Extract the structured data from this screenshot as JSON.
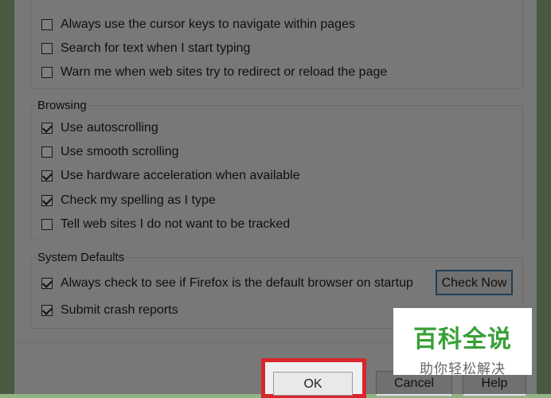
{
  "accessibility": {
    "items": [
      {
        "label": "Always use the cursor keys to navigate within pages",
        "checked": false
      },
      {
        "label": "Search for text when I start typing",
        "checked": false
      },
      {
        "label": "Warn me when web sites try to redirect or reload the page",
        "checked": false
      }
    ]
  },
  "browsing": {
    "title": "Browsing",
    "items": [
      {
        "label": "Use autoscrolling",
        "checked": true
      },
      {
        "label": "Use smooth scrolling",
        "checked": false
      },
      {
        "label": "Use hardware acceleration when available",
        "checked": true
      },
      {
        "label": "Check my spelling as I type",
        "checked": true
      },
      {
        "label": "Tell web sites I do not want to be tracked",
        "checked": false
      }
    ]
  },
  "system_defaults": {
    "title": "System Defaults",
    "items": [
      {
        "label": "Always check to see if Firefox is the default browser on startup",
        "checked": true
      },
      {
        "label": "Submit crash reports",
        "checked": true
      }
    ],
    "check_now_label": "Check Now"
  },
  "footer": {
    "ok_label": "OK",
    "cancel_label": "Cancel",
    "help_label": "Help"
  },
  "watermark": {
    "title": "百科全说",
    "subtitle": "助你轻松解决"
  },
  "colors": {
    "background_green": "#90b483",
    "highlight_red": "#d9262c",
    "watermark_green": "#38a036"
  }
}
